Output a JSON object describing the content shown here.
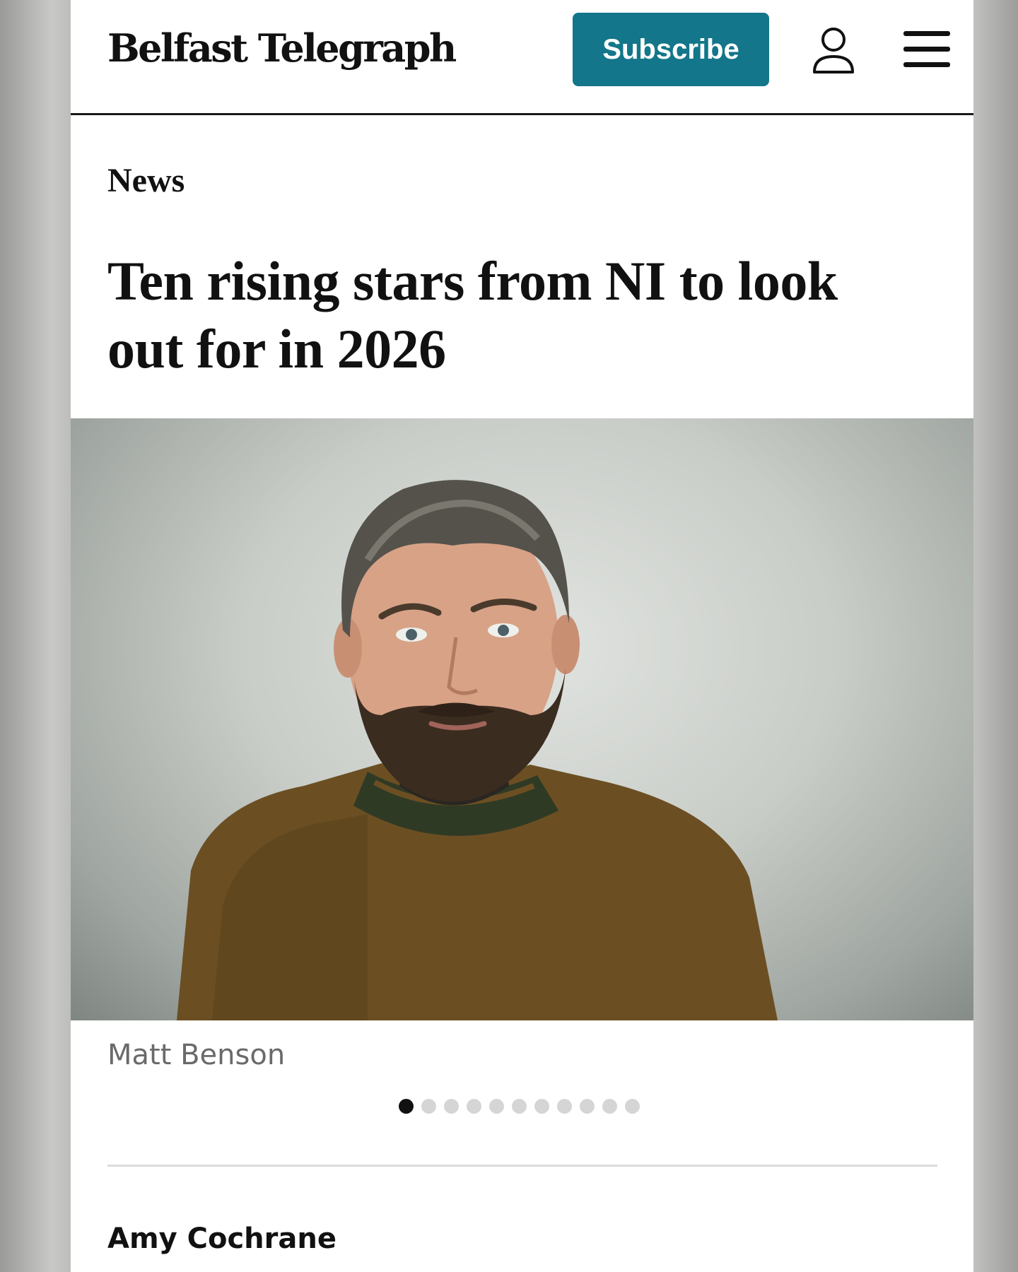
{
  "header": {
    "logo": "Belfast Telegraph",
    "subscribe_label": "Subscribe",
    "icons": [
      "user-account-icon",
      "hamburger-menu-icon"
    ],
    "accent_color": "#13768a"
  },
  "article": {
    "section": "News",
    "headline": "Ten rising stars from NI to look out for in 2026",
    "gallery": {
      "caption": "Matt Benson",
      "current_slide": 1,
      "total_slides": 11
    },
    "author": "Amy Cochrane"
  }
}
